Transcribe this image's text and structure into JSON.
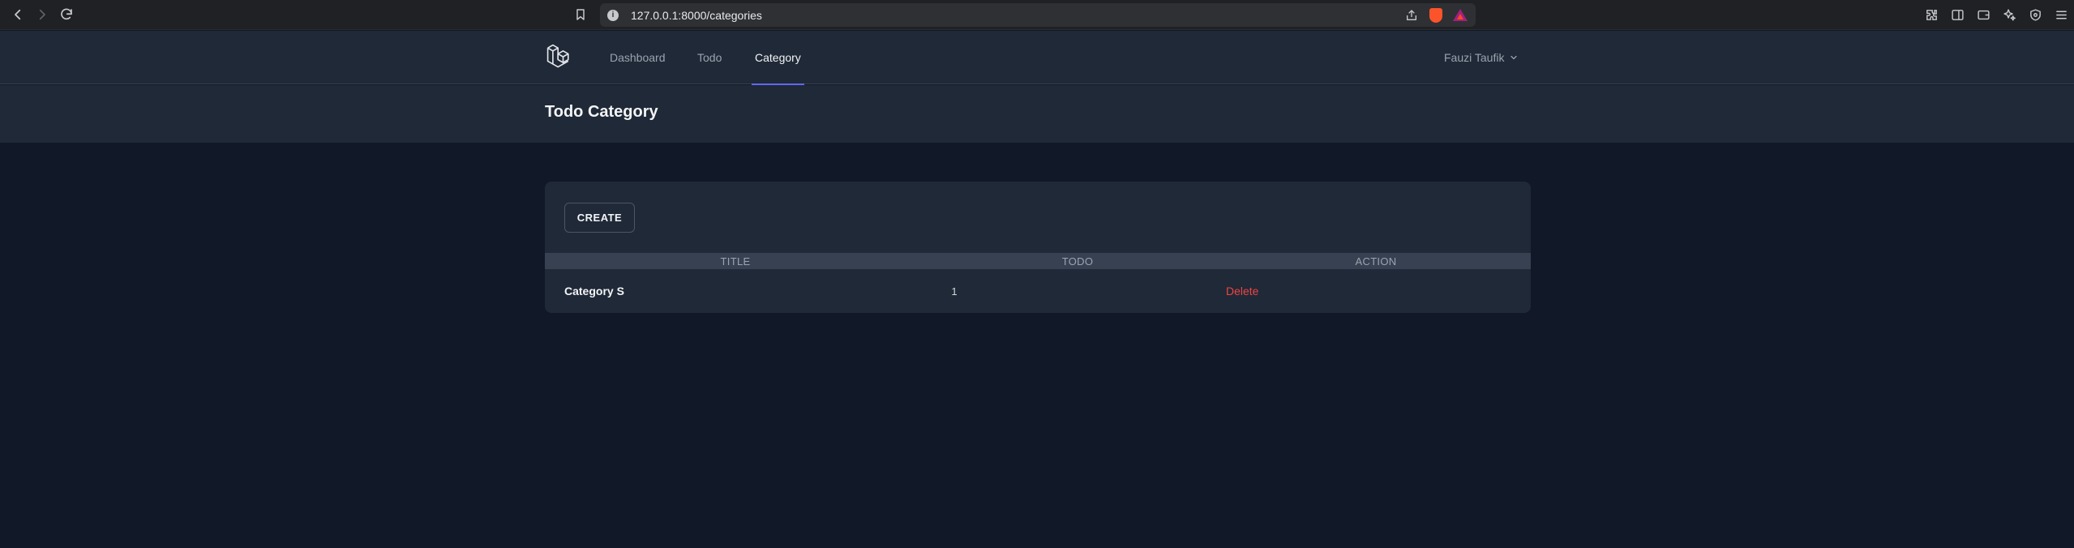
{
  "browser": {
    "url": "127.0.0.1:8000/categories"
  },
  "nav": {
    "links": [
      {
        "label": "Dashboard"
      },
      {
        "label": "Todo"
      },
      {
        "label": "Category"
      }
    ],
    "user_name": "Fauzi Taufik"
  },
  "header": {
    "title": "Todo Category"
  },
  "main": {
    "create_label": "CREATE",
    "table": {
      "columns": [
        "TITLE",
        "TODO",
        "ACTION"
      ],
      "rows": [
        {
          "title": "Category S",
          "todo": "1",
          "action": "Delete"
        }
      ]
    }
  },
  "colors": {
    "page_bg": "#111827",
    "panel_bg": "#1f2937",
    "accent": "#6366f1",
    "danger": "#ef4444"
  }
}
